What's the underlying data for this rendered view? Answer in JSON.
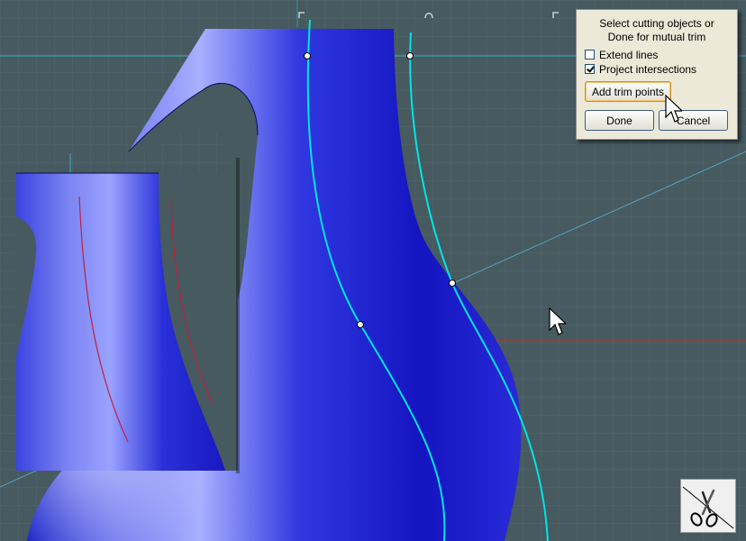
{
  "dialog": {
    "prompt_line1": "Select cutting objects or",
    "prompt_line2": "Done for mutual trim",
    "options": [
      {
        "label": "Extend lines",
        "checked": false
      },
      {
        "label": "Project intersections",
        "checked": true
      }
    ],
    "add_trim_points_label": "Add trim points",
    "done_label": "Done",
    "cancel_label": "Cancel"
  },
  "icons": {
    "trim_tool": "scissors-icon",
    "cursor": "arrow-cursor-icon"
  },
  "colors": {
    "viewport_background": "#465a60",
    "grid_line": "#52686e",
    "surface_blue": "#1a1ad8",
    "trim_curve": "#00e5e5",
    "construction_line": "#4fb8d8",
    "axis_red": "#c03030"
  }
}
